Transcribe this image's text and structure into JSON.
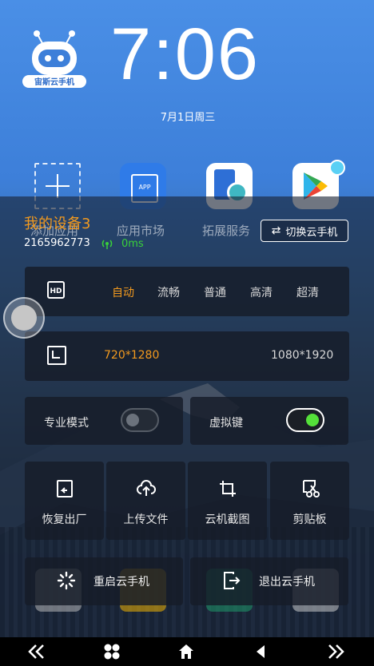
{
  "home": {
    "logo_text": "宙斯云手机",
    "time": "7:06",
    "date": "7月1日周三",
    "apps": [
      {
        "label": "添加应用",
        "icon": "add-app-icon"
      },
      {
        "label": "应用市场",
        "icon": "app-store-icon"
      },
      {
        "label": "拓展服务",
        "icon": "extension-service-icon"
      },
      {
        "label": "Play",
        "icon": "google-play-icon"
      }
    ]
  },
  "device": {
    "name": "我的设备3",
    "id": "2165962773",
    "latency": "0ms",
    "switch_label": "切换云手机"
  },
  "quality": {
    "icon_text": "HD",
    "options": [
      "自动",
      "流畅",
      "普通",
      "高清",
      "超清"
    ],
    "selected": "自动"
  },
  "resolution": {
    "options": [
      "720*1280",
      "1080*1920"
    ],
    "selected": "720*1280"
  },
  "toggles": {
    "pro_mode_label": "专业模式",
    "pro_mode_on": false,
    "virtual_key_label": "虚拟键",
    "virtual_key_on": true
  },
  "tools": [
    {
      "label": "恢复出厂",
      "icon": "factory-reset-icon"
    },
    {
      "label": "上传文件",
      "icon": "upload-icon"
    },
    {
      "label": "云机截图",
      "icon": "crop-icon"
    },
    {
      "label": "剪贴板",
      "icon": "clipboard-icon"
    }
  ],
  "actions": {
    "restart_label": "重启云手机",
    "exit_label": "退出云手机"
  },
  "nav": [
    "double-chevron-left-icon",
    "apps-grid-icon",
    "home-icon",
    "back-icon",
    "double-chevron-right-icon"
  ],
  "colors": {
    "accent": "#f39a1e",
    "latency_green": "#39d13a",
    "toggle_on": "#55e03a"
  }
}
